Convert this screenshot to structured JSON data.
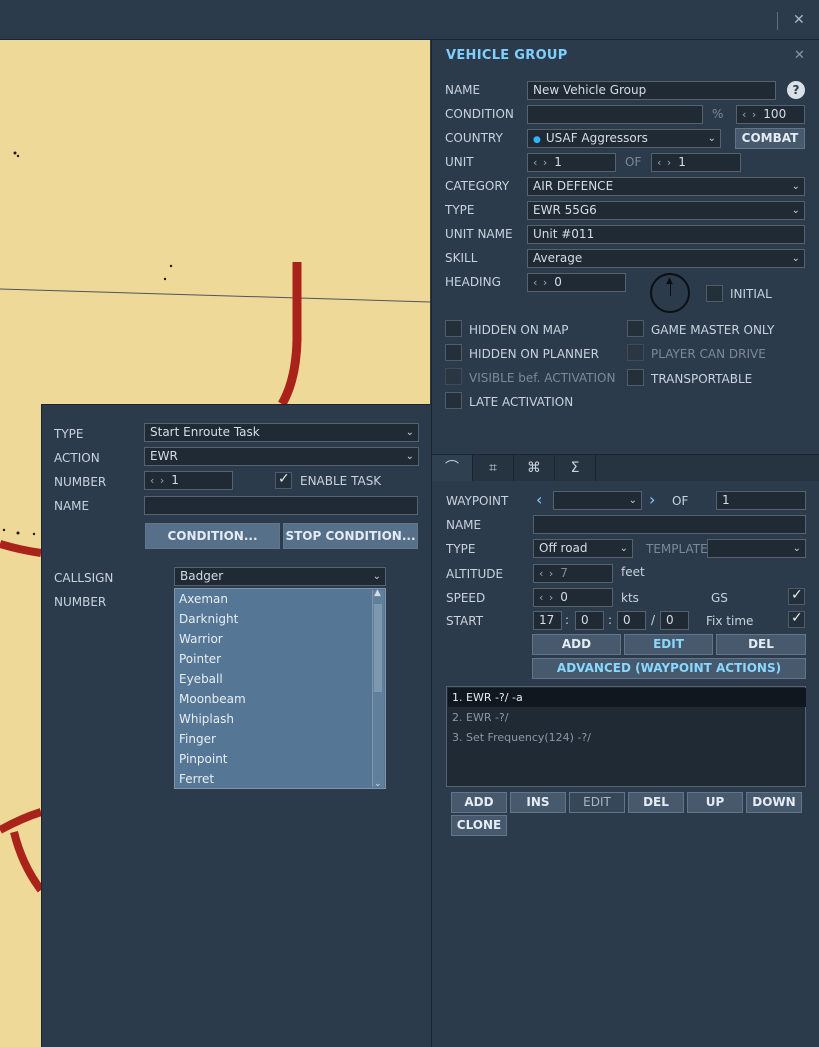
{
  "window": {
    "close_glyph": "✕"
  },
  "vehicle_group": {
    "title": "VEHICLE GROUP",
    "close_glyph": "✕",
    "name_label": "NAME",
    "name_value": "New Vehicle Group",
    "help_glyph": "?",
    "condition_label": "CONDITION",
    "condition_value": "",
    "percent_sign": "%",
    "condition_percent": "100",
    "country_label": "COUNTRY",
    "country_value": "USAF Aggressors",
    "combat_button": "COMBAT",
    "unit_label": "UNIT",
    "unit_value": "1",
    "of_label": "OF",
    "unit_of_value": "1",
    "category_label": "CATEGORY",
    "category_value": "AIR DEFENCE",
    "type_label": "TYPE",
    "type_value": "EWR 55G6",
    "unit_name_label": "UNIT NAME",
    "unit_name_value": "Unit #011",
    "skill_label": "SKILL",
    "skill_value": "Average",
    "heading_label": "HEADING",
    "heading_value": "0",
    "initial_label": "INITIAL",
    "checkboxes": {
      "hidden_on_map": "HIDDEN ON MAP",
      "game_master_only": "GAME MASTER ONLY",
      "hidden_on_planner": "HIDDEN ON PLANNER",
      "player_can_drive": "PLAYER CAN DRIVE",
      "visible_before_activation": "VISIBLE bef. ACTIVATION",
      "transportable": "TRANSPORTABLE",
      "late_activation": "LATE ACTIVATION"
    }
  },
  "tabs": [
    "route-icon",
    "target-icon",
    "command-icon",
    "summary-icon"
  ],
  "tab_glyphs": {
    "route": "⌒",
    "target": "⌗",
    "command": "⌘",
    "summary": "Σ"
  },
  "waypoint": {
    "waypoint_label": "WAYPOINT",
    "waypoint_value": "",
    "of_label": "OF",
    "of_value": "1",
    "name_label": "NAME",
    "name_value": "",
    "type_label": "TYPE",
    "type_value": "Off road",
    "template_label": "TEMPLATE",
    "template_value": "",
    "altitude_label": "ALTITUDE",
    "altitude_value": "7",
    "altitude_unit": "feet",
    "speed_label": "SPEED",
    "speed_value": "0",
    "speed_unit": "kts",
    "gs_label": "GS",
    "start_label": "START",
    "start_h": "17",
    "start_m": "0",
    "start_s": "0",
    "start_d": "0",
    "fix_time_label": "Fix time",
    "colon": ":",
    "slash": "/",
    "add_button": "ADD",
    "edit_button": "EDIT",
    "del_button": "DEL",
    "advanced_button": "ADVANCED (WAYPOINT ACTIONS)",
    "actions": [
      "1. EWR -?/ -a",
      "2. EWR -?/",
      "3. Set Frequency(124)  -?/"
    ],
    "list_buttons": {
      "add": "ADD",
      "ins": "INS",
      "edit": "EDIT",
      "del": "DEL",
      "up": "UP",
      "down": "DOWN",
      "clone": "CLONE"
    }
  },
  "task": {
    "type_label": "TYPE",
    "type_value": "Start Enroute Task",
    "action_label": "ACTION",
    "action_value": "EWR",
    "number_label": "NUMBER",
    "number_value": "1",
    "enable_task_label": "ENABLE TASK",
    "name_label": "NAME",
    "name_value": "",
    "condition_button": "CONDITION...",
    "stop_condition_button": "STOP CONDITION...",
    "callsign_label": "CALLSIGN",
    "callsign_value": "Badger",
    "number2_label": "NUMBER",
    "callsign_options": [
      "Axeman",
      "Darknight",
      "Warrior",
      "Pointer",
      "Eyeball",
      "Moonbeam",
      "Whiplash",
      "Finger",
      "Pinpoint",
      "Ferret"
    ]
  },
  "colors": {
    "map": "#efd998",
    "road": "#a9231a",
    "panel": "#2c3b4b",
    "accent": "#7fd0ff"
  }
}
